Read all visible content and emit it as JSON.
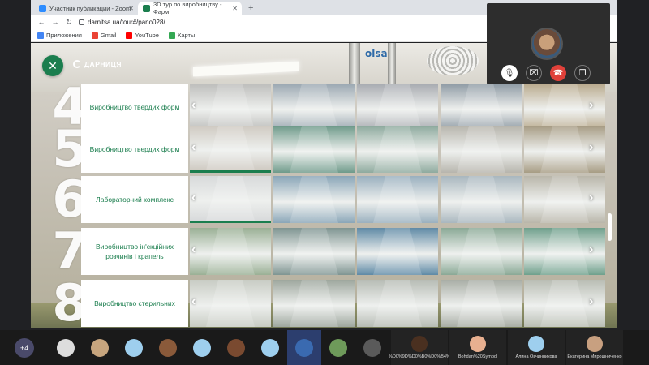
{
  "browser": {
    "tabs": [
      {
        "title": "Участник публикации - Zoom",
        "color": "#2d8cff"
      },
      {
        "title": "3D тур по виробництву - Фарм",
        "color": "#1b7e4e"
      }
    ],
    "url": "darnitsa.ua/tour#/pano028/",
    "bookmarks": [
      {
        "label": "Приложения",
        "color": "#4285f4"
      },
      {
        "label": "Gmail",
        "color": "#ea4335"
      },
      {
        "label": "YouTube",
        "color": "#ff0000"
      },
      {
        "label": "Карты",
        "color": "#34a853"
      }
    ]
  },
  "page": {
    "brand_name": "ДАРНИЦЯ",
    "scene_label": "olsa",
    "accent": "#1b7e4e",
    "rows": [
      {
        "number": "4",
        "label": "Виробництво твердих форм",
        "thumb_colors": [
          "#bdbdbb",
          "#9aa7b1",
          "#a7aab0",
          "#8e9aa4",
          "#b8a98c"
        ]
      },
      {
        "number": "5",
        "label": "Виробництво твердих форм",
        "thumb_colors": [
          "#cfcac2",
          "#6e9a8a",
          "#8eaa9e",
          "#b7b5ad",
          "#a79c84"
        ]
      },
      {
        "number": "6",
        "label": "Лабораторний комплекс",
        "thumb_colors": [
          "#d8dadb",
          "#8aa6b8",
          "#9ab0bf",
          "#a9b7bf",
          "#b9b6aa"
        ]
      },
      {
        "number": "7",
        "label": "Виробництво ін'єкційних розчинів і крапель",
        "thumb_colors": [
          "#9ab095",
          "#7f9592",
          "#5f8aa6",
          "#8aa996",
          "#6fa08c"
        ]
      },
      {
        "number": "8",
        "label": "Виробництво стерильних",
        "thumb_colors": [
          "#c8ccc4",
          "#9ea79e",
          "#b7bcb5",
          "#a9aea6",
          "#b9bdb4"
        ]
      }
    ]
  },
  "zoom": {
    "more_count": "+4",
    "participants": [
      {
        "color": "#ddd"
      },
      {
        "color": "#c7a57e"
      },
      {
        "color": "#9ecfee"
      },
      {
        "color": "#8a5a3a"
      },
      {
        "color": "#9ecfee"
      },
      {
        "color": "#7a4a30"
      },
      {
        "color": "#9ecfee"
      },
      {
        "color": "#3a6ab0"
      },
      {
        "color": "#6e9a5a"
      },
      {
        "color": "#5a5a5a"
      }
    ],
    "named": [
      {
        "name": "%D0%9D%D0%B0%D0%B4%D0%B5%D0%B6...",
        "color": "#4a3020"
      },
      {
        "name": "Bohdan%20Symbol",
        "color": "#e8b090"
      },
      {
        "name": "Алина Овчинникова",
        "color": "#9ecfee"
      },
      {
        "name": "Екатерина Мирошниченко",
        "color": "#c8a080"
      }
    ]
  }
}
